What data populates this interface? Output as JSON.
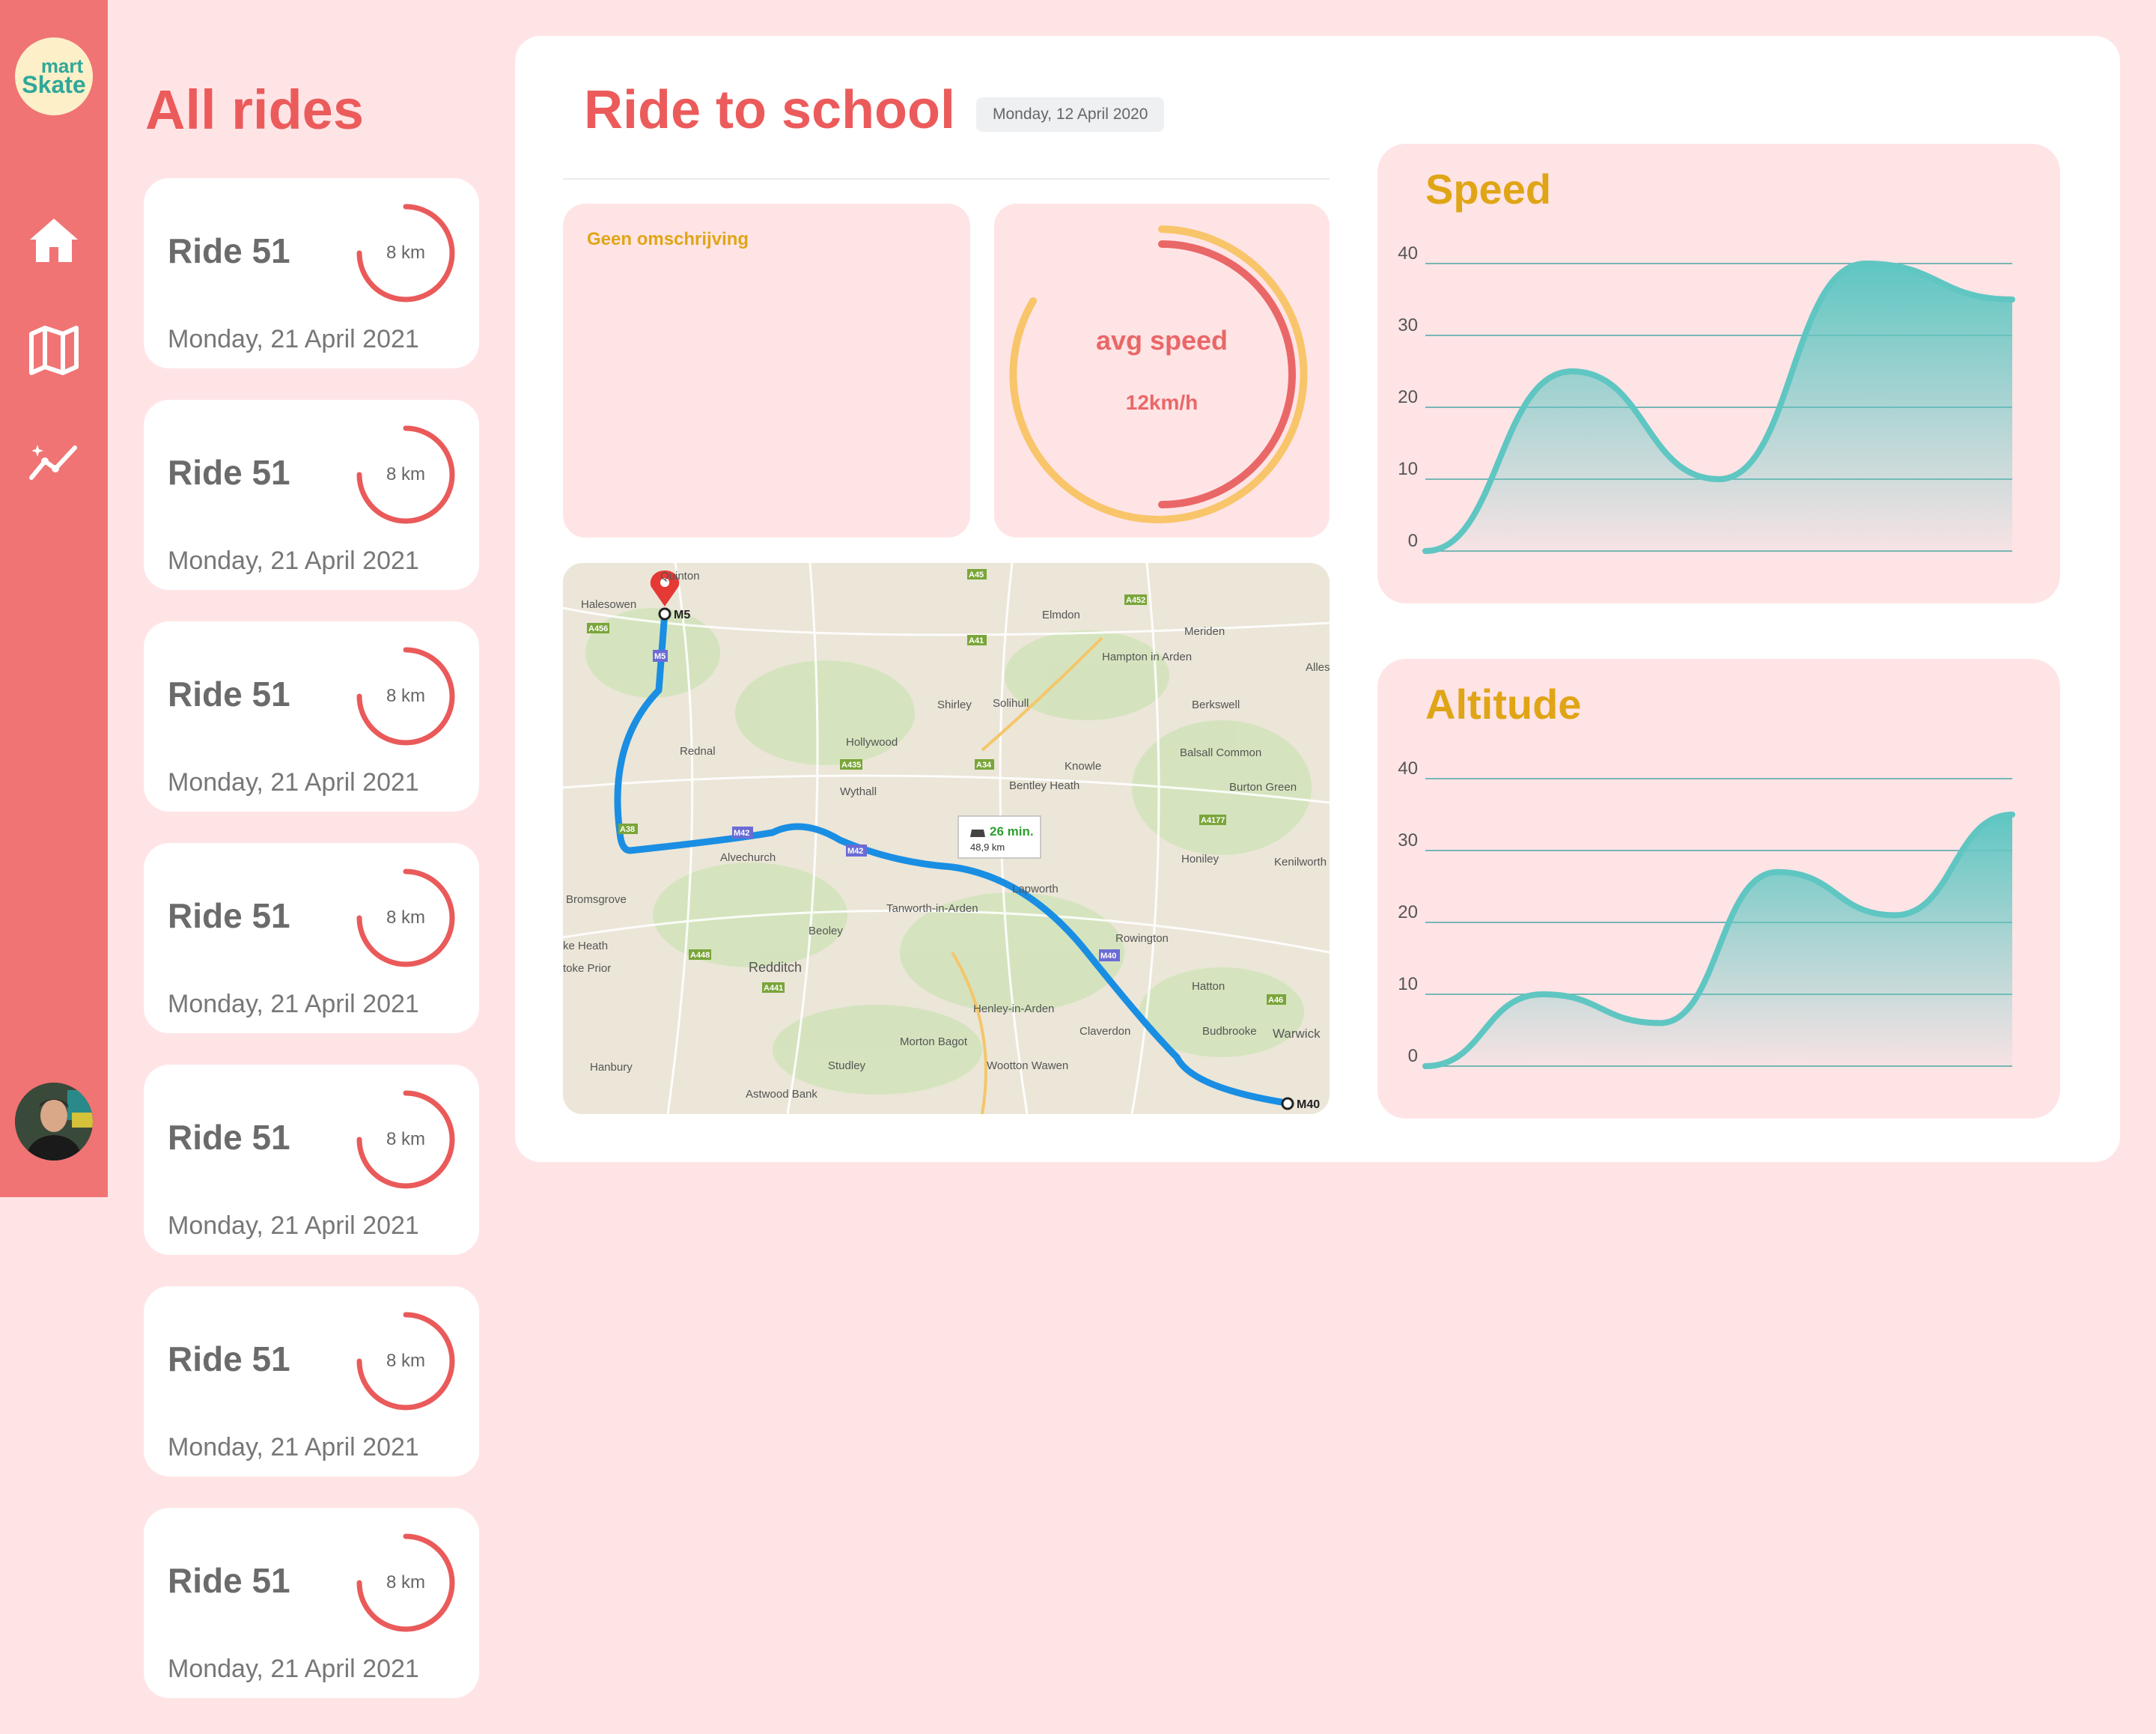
{
  "app": {
    "logo_line1": "mart",
    "logo_line2": "Skate"
  },
  "nav": [
    {
      "icon": "home-icon"
    },
    {
      "icon": "map-icon"
    },
    {
      "icon": "stats-icon"
    }
  ],
  "rides": {
    "title": "All rides",
    "items": [
      {
        "name": "Ride 51",
        "distance": "8 km",
        "date": "Monday, 21 April 2021"
      },
      {
        "name": "Ride 51",
        "distance": "8 km",
        "date": "Monday, 21 April 2021"
      },
      {
        "name": "Ride 51",
        "distance": "8 km",
        "date": "Monday, 21 April 2021"
      },
      {
        "name": "Ride 51",
        "distance": "8 km",
        "date": "Monday, 21 April 2021"
      },
      {
        "name": "Ride 51",
        "distance": "8 km",
        "date": "Monday, 21 April 2021"
      },
      {
        "name": "Ride 51",
        "distance": "8 km",
        "date": "Monday, 21 April 2021"
      },
      {
        "name": "Ride 51",
        "distance": "8 km",
        "date": "Monday, 21 April 2021"
      }
    ]
  },
  "detail": {
    "title": "Ride to school",
    "date": "Monday, 12 April 2020",
    "description": "Geen omschrijving",
    "avg_speed_label": "avg speed",
    "avg_speed_value": "12km/h",
    "map": {
      "places": [
        "Quinton",
        "Halesowen",
        "Elmdon",
        "Hampton in Arden",
        "Meriden",
        "Solihull",
        "Shirley",
        "Rednal",
        "Hollywood",
        "Wythall",
        "Knowle",
        "Bentley Heath",
        "Berkswell",
        "Balsall Common",
        "Burton Green",
        "Alvechurch",
        "Bromsgrove",
        "Honiley",
        "Kenilworth",
        "Tanworth-in-Arden",
        "Lapworth",
        "Beoley",
        "Redditch",
        "Rowington",
        "Hatton",
        "Henley-in-Arden",
        "Claverdon",
        "Budbrooke",
        "Warwick",
        "Morton Bagot",
        "Hanbury",
        "Studley",
        "Wootton Wawen",
        "Astwood Bank",
        "Allesley",
        "ke Heath",
        "toke Prior"
      ],
      "roads": [
        "M5",
        "M42",
        "M40",
        "A38",
        "A435",
        "A34",
        "A41",
        "A45",
        "A452",
        "A456",
        "A441",
        "A448",
        "A4177",
        "A46",
        "M42"
      ],
      "travel_time": "26 min.",
      "travel_distance": "48,9 km",
      "start_label": "M5",
      "end_label": "M40"
    }
  },
  "chart_data": [
    {
      "type": "area",
      "title": "Speed",
      "x": [
        0,
        1,
        2,
        3,
        4,
        5
      ],
      "y": [
        0,
        25,
        10,
        40,
        35
      ],
      "ylim": [
        0,
        40
      ],
      "yticks": [
        0,
        10,
        20,
        30,
        40
      ],
      "xlabel": "",
      "ylabel": "",
      "grid": true
    },
    {
      "type": "area",
      "title": "Altitude",
      "x": [
        0,
        1,
        2,
        3,
        4,
        5
      ],
      "y": [
        0,
        10,
        6,
        27,
        21,
        35
      ],
      "ylim": [
        0,
        40
      ],
      "yticks": [
        0,
        10,
        20,
        30,
        40
      ],
      "xlabel": "",
      "ylabel": "",
      "grid": true
    }
  ],
  "colors": {
    "accent": "#ec5b5b",
    "sidebar": "#f07474",
    "background": "#ffe4e6",
    "chart_title": "#e0a516",
    "chart_line": "#5fc6c2",
    "gauge_outer": "#f9c56a",
    "gauge_inner": "#ea6767"
  }
}
